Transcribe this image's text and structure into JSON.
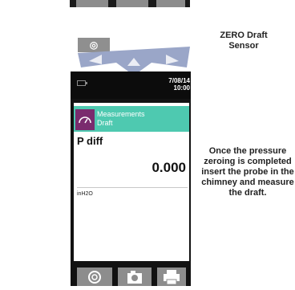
{
  "keypad": {
    "key_symbol": "◎"
  },
  "labels": {
    "zero_draft": "ZERO Draft Sensor",
    "instruction": "Once the pressure zeroing is completed insert the probe in the chimney and measure the draft."
  },
  "status": {
    "date": "7/08/14",
    "time": "10:00"
  },
  "header": {
    "title": "Measurements",
    "subtitle": "Draft",
    "icon": "gauge-icon"
  },
  "measurement": {
    "name": "P diff",
    "value": "0.000",
    "unit": "inH2O"
  },
  "buttons": [
    {
      "icon": "zero-icon"
    },
    {
      "icon": "camera-icon"
    },
    {
      "icon": "print-icon"
    }
  ],
  "colors": {
    "accent": "#4ec9b0",
    "icon_bg": "#7a2c6e",
    "keypad": "#9aa6c8"
  }
}
